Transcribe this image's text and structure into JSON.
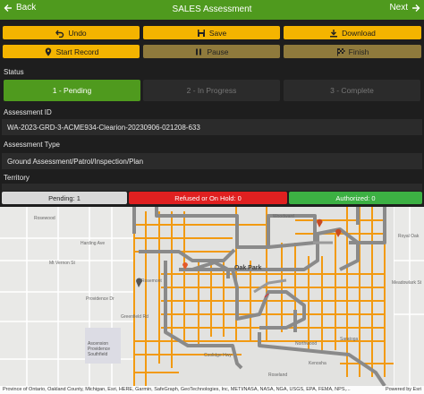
{
  "header": {
    "back_label": "Back",
    "title": "SALES Assessment",
    "next_label": "Next",
    "color": "#4f9a1e"
  },
  "toolbar": {
    "undo_label": "Undo",
    "save_label": "Save",
    "download_label": "Download",
    "start_record_label": "Start Record",
    "pause_label": "Pause",
    "finish_label": "Finish",
    "accent": "#f4b400"
  },
  "status": {
    "heading": "Status",
    "tabs": [
      {
        "label": "1 - Pending",
        "active": true
      },
      {
        "label": "2 - In Progress",
        "active": false
      },
      {
        "label": "3 - Complete",
        "active": false
      }
    ]
  },
  "assessment_id": {
    "heading": "Assessment ID",
    "value": "WA-2023-GRD-3-ACME934-Clearion-20230906-021208-633"
  },
  "assessment_type": {
    "heading": "Assessment Type",
    "value": "Ground Assessment/Patrol/Inspection/Plan"
  },
  "territory": {
    "heading": "Territory"
  },
  "counts": {
    "pending": "Pending: 1",
    "refused": "Refused or On Hold: 0",
    "authorized": "Authorized: 0",
    "colors": {
      "pending": "#d8d8d8",
      "refused": "#e02020",
      "authorized": "#3cb043"
    }
  },
  "map": {
    "city_label": "Oak Park",
    "street_labels": [
      "Rosewood",
      "Mt Vernon St",
      "Harding Ave",
      "Providence Dr",
      "Greenfield Rd",
      "Ascension Providence Southfield",
      "Rosemont",
      "Coolidge Hwy",
      "Northwood",
      "Saratoga",
      "Woodward",
      "Royal Oak",
      "Meadowlark St",
      "Kenosha",
      "Roseland"
    ],
    "attribution": "Province of Ontario, Oakland County, Michigan, Esri, HERE, Garmin, SafeGraph, GeoTechnologies, Inc, METI/NASA, NASA, NGA, USGS, EPA, FEMA, NPS,...",
    "powered_by": "Powered by Esri"
  }
}
